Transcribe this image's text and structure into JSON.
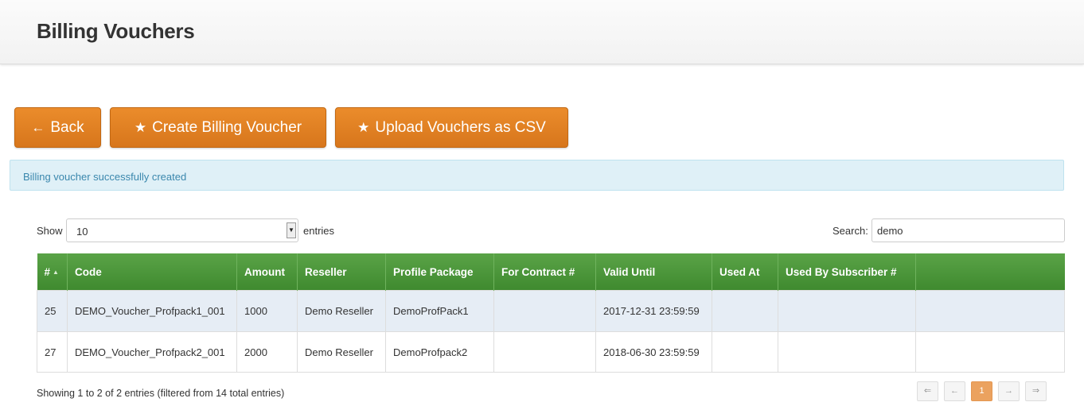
{
  "page": {
    "title": "Billing Vouchers"
  },
  "toolbar": {
    "back_label": "Back",
    "create_label": "Create Billing Voucher",
    "upload_label": "Upload Vouchers as CSV"
  },
  "alert": {
    "message": "Billing voucher successfully created"
  },
  "length": {
    "show_label": "Show",
    "value": "10",
    "entries_label": "entries"
  },
  "search": {
    "label": "Search:",
    "value": "demo"
  },
  "table": {
    "columns": [
      "#",
      "Code",
      "Amount",
      "Reseller",
      "Profile Package",
      "For Contract #",
      "Valid Until",
      "Used At",
      "Used By Subscriber #",
      ""
    ],
    "rows": [
      [
        "25",
        "DEMO_Voucher_Profpack1_001",
        "1000",
        "Demo Reseller",
        "DemoProfPack1",
        "",
        "2017-12-31 23:59:59",
        "",
        "",
        ""
      ],
      [
        "27",
        "DEMO_Voucher_Profpack2_001",
        "2000",
        "Demo Reseller",
        "DemoProfpack2",
        "",
        "2018-06-30 23:59:59",
        "",
        "",
        ""
      ]
    ]
  },
  "info": "Showing 1 to 2 of 2 entries (filtered from 14 total entries)",
  "pagination": {
    "first": "⇐",
    "prev": "←",
    "current": "1",
    "next": "→",
    "last": "⇒"
  },
  "icons": {
    "back": "arrow-left-icon",
    "create": "star-icon",
    "upload": "star-icon",
    "sort": "sort-asc-icon",
    "select_arrow": "chevron-down-icon"
  },
  "colors": {
    "accent": "#e07f22",
    "header_green": "#4a9a3a",
    "alert_bg": "#dff0f7",
    "alert_text": "#3a87ad",
    "row_alt": "#e6edf5"
  }
}
